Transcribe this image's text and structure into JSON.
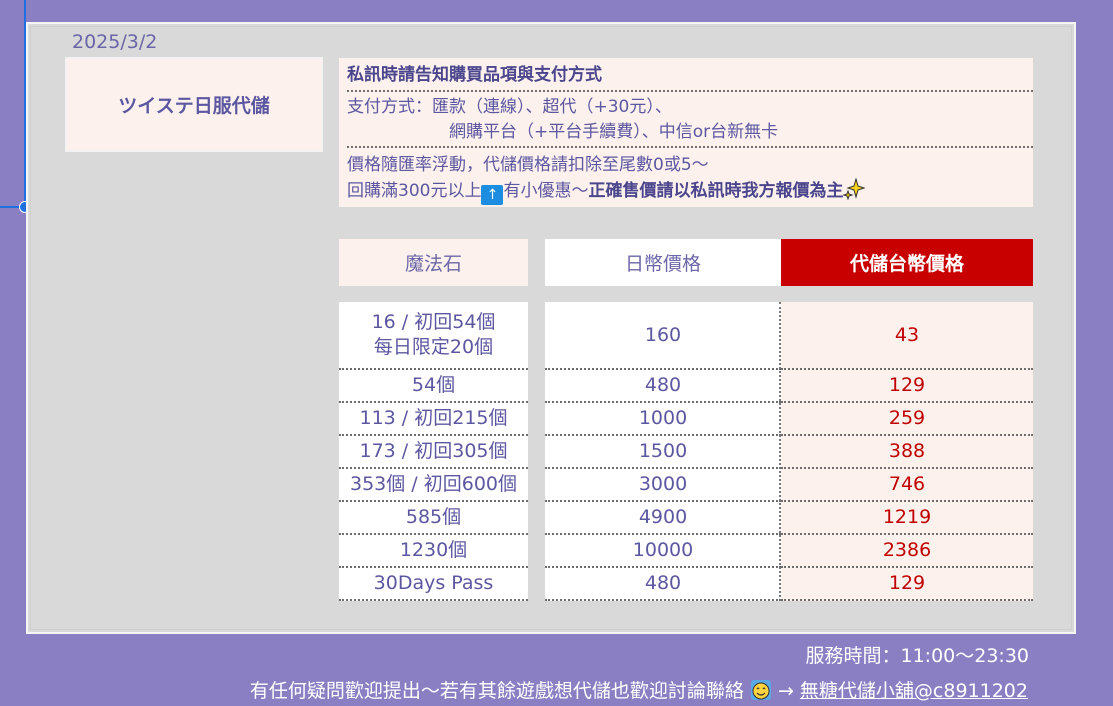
{
  "date": "2025/3/2",
  "shop_name": "ツイステ日服代儲",
  "info": {
    "line1": "私訊時請告知購買品項與支付方式",
    "payment_line1": "支付方式：匯款（連線）、超代（+30元）、",
    "payment_line2": "網購平台（+平台手續費）、中信or台新無卡",
    "note_line1": "價格隨匯率浮動，代儲價格請扣除至尾數0或5～",
    "note_line2_a": "回購滿300元以上",
    "note_line2_b": "有小優惠～",
    "note_line2_bold": "正確售價請以私訊時我方報價為主"
  },
  "table": {
    "headers": [
      "魔法石",
      "日幣價格",
      "代儲台幣價格"
    ],
    "rows": [
      {
        "stones_line1": "16 / 初回54個",
        "stones_line2": "每日限定20個",
        "jpy": "160",
        "twd": "43"
      },
      {
        "stones_line1": "54個",
        "stones_line2": "",
        "jpy": "480",
        "twd": "129"
      },
      {
        "stones_line1": "113 / 初回215個",
        "stones_line2": "",
        "jpy": "1000",
        "twd": "259"
      },
      {
        "stones_line1": "173 / 初回305個",
        "stones_line2": "",
        "jpy": "1500",
        "twd": "388"
      },
      {
        "stones_line1": "353個 / 初回600個",
        "stones_line2": "",
        "jpy": "3000",
        "twd": "746"
      },
      {
        "stones_line1": "585個",
        "stones_line2": "",
        "jpy": "4900",
        "twd": "1219"
      },
      {
        "stones_line1": "1230個",
        "stones_line2": "",
        "jpy": "10000",
        "twd": "2386"
      },
      {
        "stones_line1": "30Days Pass",
        "stones_line2": "",
        "jpy": "480",
        "twd": "129"
      }
    ]
  },
  "footer": {
    "hours": "服務時間：11:00～23:30",
    "message": "有任何疑問歡迎提出～若有其餘遊戲想代儲也歡迎討論聯絡",
    "arrow": "→",
    "contact": "無糖代儲小舖@c8911202"
  },
  "colors": {
    "accent_red": "#c90000",
    "text_purple": "#5c57a1",
    "background": "#8b7fc3",
    "blue_handle": "#1f6fe0"
  },
  "icons": [
    "up-arrow-icon",
    "sparkle-icon",
    "smiling-face-emoji-icon"
  ]
}
